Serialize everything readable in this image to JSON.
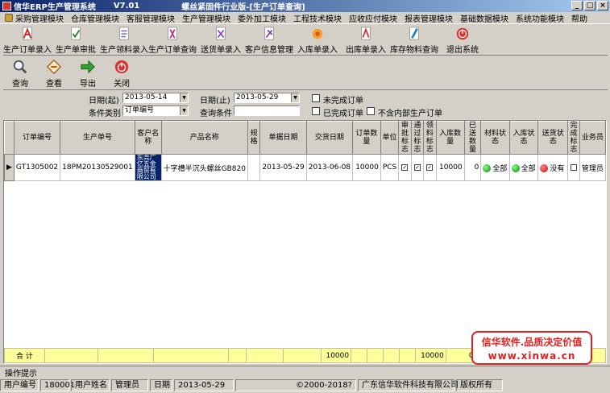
{
  "window": {
    "app_name": "信华ERP生产管理系统",
    "version": "V7.01",
    "industry": "螺丝紧固件行业版",
    "module_title": "-[生产订单查询]",
    "btn_min": "_",
    "btn_max": "□",
    "btn_close": "×"
  },
  "menu": [
    "采购管理模块",
    "仓库管理模块",
    "客服管理模块",
    "生产管理模块",
    "委外加工模块",
    "工程技术模块",
    "应收应付模块",
    "报表管理模块",
    "基础数据模块",
    "系统功能模块",
    "帮助"
  ],
  "toolbar": [
    {
      "label": "生产订单录入",
      "icon": "pdf-doc-icon",
      "color": "#d02020"
    },
    {
      "label": "生产单审批",
      "icon": "approve-doc-icon",
      "color": "#208020"
    },
    {
      "label": "生产领料录入",
      "icon": "material-doc-icon",
      "color": "#6060c0"
    },
    {
      "label": "生产订单查询",
      "icon": "query-doc-icon",
      "color": "#c03070"
    },
    {
      "label": "送货单录入",
      "icon": "delivery-doc-icon",
      "color": "#9040c0"
    },
    {
      "label": "客户信息管理",
      "icon": "customer-doc-icon",
      "color": "#8040a0"
    },
    {
      "label": "入库单录入",
      "icon": "stock-in-icon",
      "color": "#e08020"
    },
    {
      "label": "出库单录入",
      "icon": "stock-out-icon",
      "color": "#d03030"
    },
    {
      "label": "库存物料查询",
      "icon": "inventory-icon",
      "color": "#2080c0"
    },
    {
      "label": "退出系统",
      "icon": "exit-icon",
      "color": "#e03030"
    }
  ],
  "actions": [
    {
      "label": "查询",
      "icon": "magnifier-icon"
    },
    {
      "label": "查看",
      "icon": "view-icon"
    },
    {
      "label": "导出",
      "icon": "export-arrow-icon"
    },
    {
      "label": "关闭",
      "icon": "power-icon"
    }
  ],
  "filter": {
    "date_from_label": "日期(起)",
    "date_from": "2013-05-14",
    "date_to_label": "日期(止)",
    "date_to": "2013-05-29",
    "category_label": "条件类别",
    "category_value": "订单编号",
    "condition_label": "查询条件",
    "condition_value": "",
    "incomplete_label": "未完成订单",
    "complete_label": "已完成订单",
    "exclude_internal_label": "不含内部生产订单"
  },
  "grid": {
    "columns": [
      "订单编号",
      "生产单号",
      "客户名称",
      "产品名称",
      "规格",
      "单据日期",
      "交货日期",
      "订单数量",
      "单位",
      "审批标志",
      "通过标志",
      "领料标志",
      "入库数量",
      "已送数量",
      "材料状态",
      "入库状态",
      "送货状态",
      "完成标志",
      "业务员"
    ],
    "rows": [
      {
        "order_no": "GT1305002",
        "prod_no": "18PM20130529001",
        "customer": "东莞广亿五金商贸有限公司",
        "product": "十字槽半沉头螺丝GB820",
        "spec": "",
        "doc_date": "2013-05-29",
        "delivery_date": "2013-06-08",
        "qty": "10000",
        "unit": "PCS",
        "stock_in_qty": "10000",
        "sent_qty": "0",
        "material_status": "全部",
        "stock_status": "全部",
        "delivery_status": "没有",
        "salesman": "管理员"
      }
    ],
    "totals": {
      "label": "合 计",
      "qty": "10000",
      "stock_in_qty": "10000",
      "sent_qty": "0"
    }
  },
  "watermark": {
    "line1": "信华软件.品质决定价值",
    "line2": "www.xinwa.cn"
  },
  "hint": "操作提示",
  "status": {
    "user_no_label": "用户编号",
    "user_no": "180001",
    "user_name_label": "用户姓名",
    "user_name": "管理员",
    "date_label": "日期",
    "date": "2013-05-29",
    "copyright": "©2000-2018?",
    "company": "广东信华软件科技有限公司",
    "rights": "版权所有"
  }
}
